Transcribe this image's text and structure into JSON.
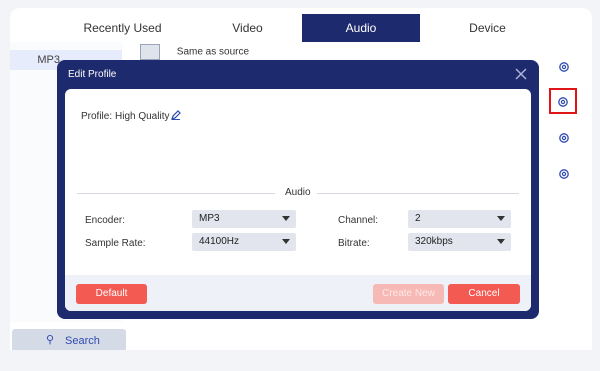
{
  "tabs": [
    {
      "label": "Recently Used",
      "active": false
    },
    {
      "label": "Video",
      "active": false
    },
    {
      "label": "Audio",
      "active": true
    },
    {
      "label": "Device",
      "active": false
    }
  ],
  "side_list": [
    "MP3"
  ],
  "content_row": {
    "label": "Same as source"
  },
  "search": {
    "label": "Search"
  },
  "dialog": {
    "title": "Edit Profile",
    "profile_label": "Profile:",
    "profile_value": "High Quality",
    "section_title": "Audio",
    "fields": {
      "encoder": {
        "label": "Encoder:",
        "value": "MP3"
      },
      "channel": {
        "label": "Channel:",
        "value": "2"
      },
      "sample_rate": {
        "label": "Sample Rate:",
        "value": "44100Hz"
      },
      "bitrate": {
        "label": "Bitrate:",
        "value": "320kbps"
      }
    },
    "buttons": {
      "default": "Default",
      "create_new": "Create New",
      "cancel": "Cancel"
    }
  },
  "colors": {
    "navy": "#1e2a6e",
    "accent_red": "#f25a52",
    "highlight_red": "#e01515",
    "gear_blue": "#2f4ab0"
  },
  "icons": [
    "gear-icon",
    "close-icon",
    "edit-icon",
    "search-icon",
    "chevron-down-icon"
  ]
}
